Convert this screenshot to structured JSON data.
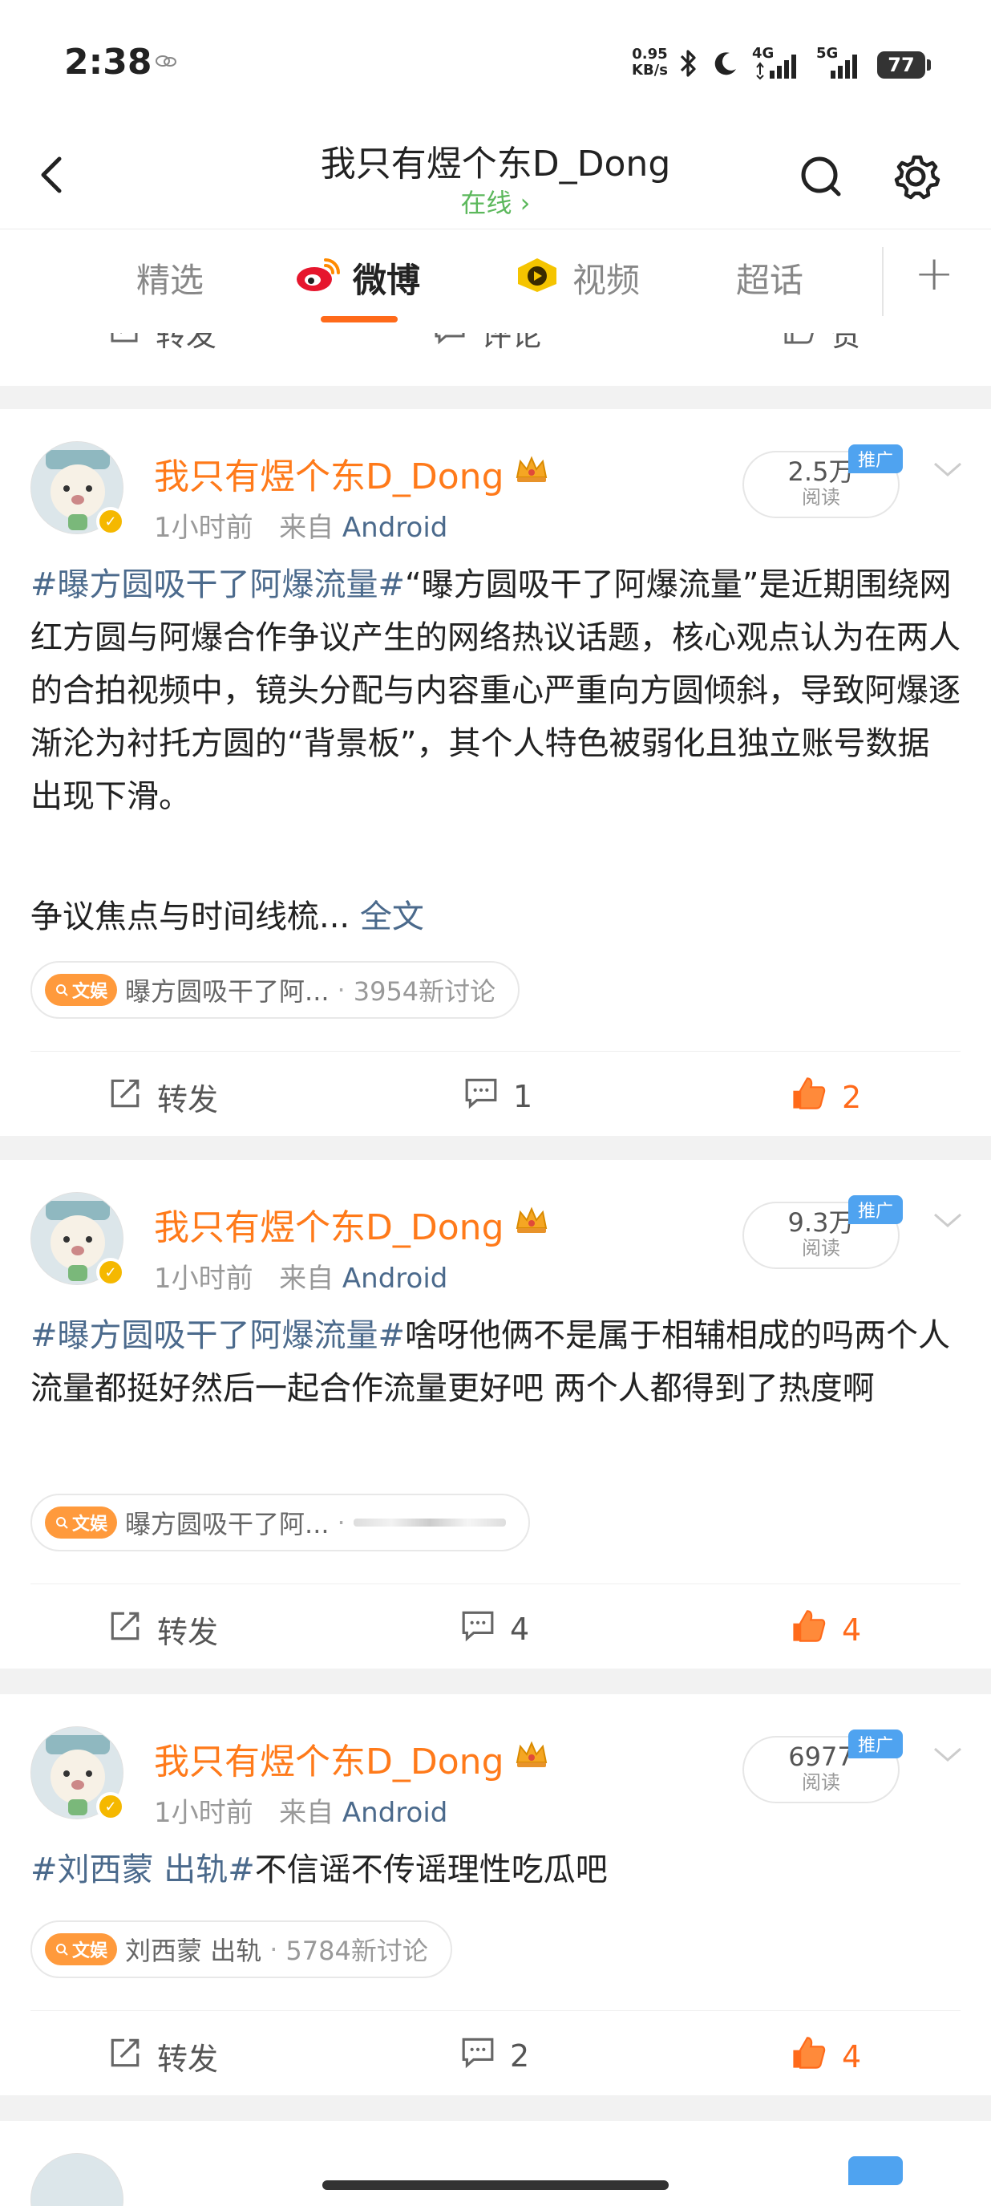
{
  "status": {
    "time": "2:38",
    "speed_value": "0.95",
    "speed_unit": "KB/s",
    "net1": "4G",
    "net2": "5G",
    "battery": "77"
  },
  "header": {
    "title": "我只有煜个东D_Dong",
    "subtitle": "在线 ›"
  },
  "tabs": [
    {
      "label": "精选"
    },
    {
      "label": "微博"
    },
    {
      "label": "视频"
    },
    {
      "label": "超话"
    }
  ],
  "top_actions": {
    "repost": "转发",
    "comment": "评论",
    "like": "赞"
  },
  "posts": [
    {
      "author": "我只有煜个东D_Dong",
      "time": "1小时前",
      "from": "来自",
      "source": "Android",
      "reads_num": "2.5万",
      "reads_label": "阅读",
      "promo": "推广",
      "hashtag": "#曝方圆吸干了阿爆流量#",
      "text": "“曝方圆吸干了阿爆流量”是近期围绕网红方圆与阿爆合作争议产生的网络热议话题，核心观点认为在两人的合拍视频中，镜头分配与内容重心严重向方圆倾斜，导致阿爆逐渐沦为衬托方圆的“背景板”，其个人特色被弱化且独立账号数据出现下滑。",
      "text2": "争议焦点与时间线梳...",
      "more": "全文",
      "chip_badge": "文娱",
      "chip_title": "曝方圆吸干了阿...",
      "chip_sep": "·",
      "chip_count": "3954新讨论",
      "repost": "转发",
      "comments": "1",
      "likes": "2"
    },
    {
      "author": "我只有煜个东D_Dong",
      "time": "1小时前",
      "from": "来自",
      "source": "Android",
      "reads_num": "9.3万",
      "reads_label": "阅读",
      "promo": "推广",
      "hashtag": "#曝方圆吸干了阿爆流量#",
      "text": "啥呀他俩不是属于相辅相成的吗两个人流量都挺好然后一起合作流量更好吧 两个人都得到了热度啊",
      "chip_badge": "文娱",
      "chip_title": "曝方圆吸干了阿...",
      "chip_sep": "·",
      "repost": "转发",
      "comments": "4",
      "likes": "4"
    },
    {
      "author": "我只有煜个东D_Dong",
      "time": "1小时前",
      "from": "来自",
      "source": "Android",
      "reads_num": "6977",
      "reads_label": "阅读",
      "promo": "推广",
      "hashtag": "#刘西蒙 出轨#",
      "text": "不信谣不传谣理性吃瓜吧",
      "chip_badge": "文娱",
      "chip_title": "刘西蒙 出轨",
      "chip_sep": "·",
      "chip_count": "5784新讨论",
      "repost": "转发",
      "comments": "2",
      "likes": "4"
    }
  ],
  "colors": {
    "accent": "#ff6a1a",
    "author": "#ff7a1a",
    "link": "#4b6a8c",
    "promo": "#4fa3f0",
    "online": "#5cb85c"
  }
}
